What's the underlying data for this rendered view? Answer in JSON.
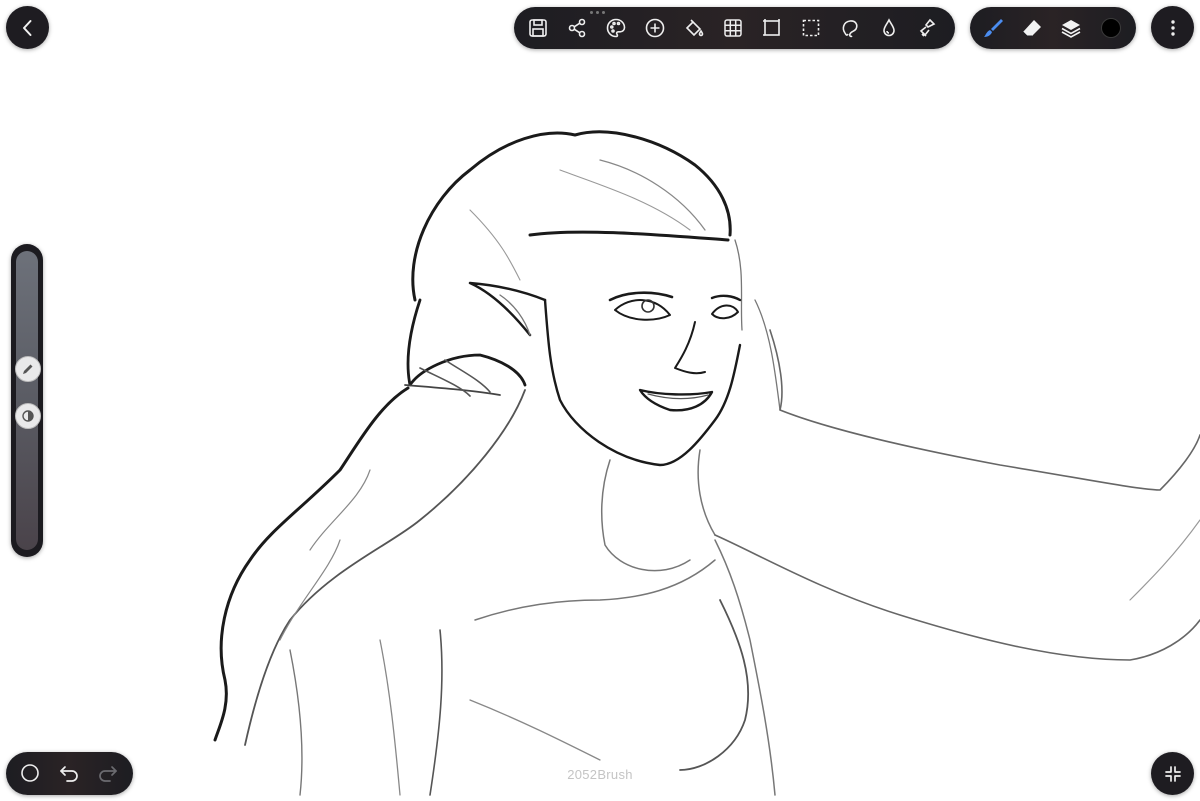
{
  "app": {
    "watermark": "2052Brush"
  },
  "top_toolbar": {
    "tools": [
      "save-icon",
      "share-icon",
      "palette-icon",
      "add-icon",
      "fill-bucket-icon",
      "grid-icon",
      "transform-icon",
      "selection-icon",
      "lasso-icon",
      "smudge-icon",
      "clear-icon"
    ]
  },
  "brush_toolbar": {
    "tools": [
      "brush-icon",
      "eraser-icon",
      "layers-icon",
      "color-swatch"
    ],
    "active_tool": "brush",
    "current_color": "#000000",
    "accent_color": "#4b8df0"
  },
  "side_slider": {
    "brush_size": "pencil-icon",
    "opacity": "opacity-icon"
  },
  "bottom_left": {
    "tools": [
      "shape-circle-icon",
      "undo-icon",
      "redo-icon"
    ]
  },
  "bottom_right": {
    "tools": [
      "fullscreen-icon"
    ]
  }
}
